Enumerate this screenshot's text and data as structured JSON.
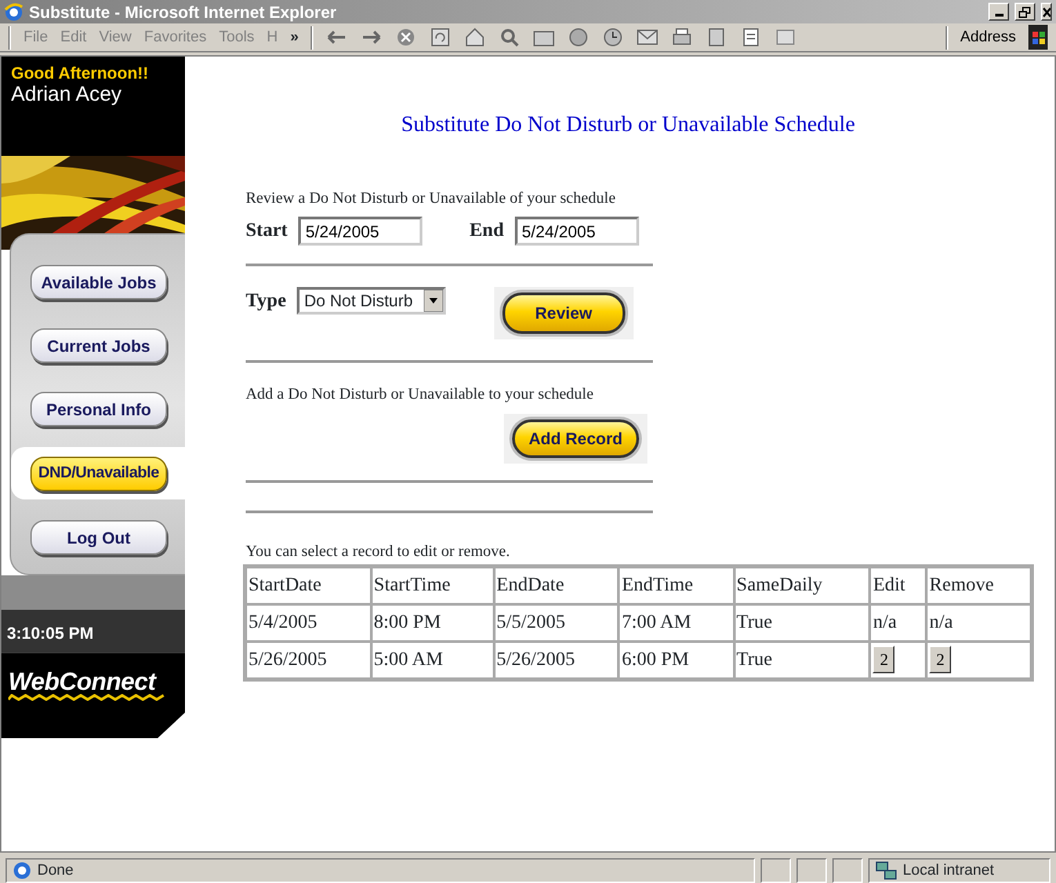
{
  "window": {
    "title": "Substitute - Microsoft Internet Explorer"
  },
  "menu": [
    {
      "label": "File"
    },
    {
      "label": "Edit"
    },
    {
      "label": "View"
    },
    {
      "label": "Favorites"
    },
    {
      "label": "Tools"
    },
    {
      "label": "H"
    }
  ],
  "menu_more": "»",
  "address_label": "Address",
  "sidebar": {
    "greeting": "Good Afternoon!!",
    "user_name": "Adrian Acey",
    "nav": [
      {
        "label": "Available Jobs",
        "selected": false
      },
      {
        "label": "Current Jobs",
        "selected": false
      },
      {
        "label": "Personal Info",
        "selected": false
      },
      {
        "label": "DND/Unavailable",
        "selected": true
      },
      {
        "label": "Log Out",
        "selected": false
      }
    ],
    "clock": "3:10:05 PM",
    "logo": "WebConnect"
  },
  "page": {
    "title": "Substitute Do Not Disturb or Unavailable Schedule",
    "review": {
      "caption": "Review a Do Not Disturb or Unavailable of your schedule",
      "start_label": "Start",
      "start_value": "5/24/2005",
      "end_label": "End",
      "end_value": "5/24/2005",
      "type_label": "Type",
      "type_value": "Do Not Disturb",
      "button": "Review"
    },
    "add": {
      "caption": "Add a Do Not Disturb or Unavailable to your schedule",
      "button": "Add Record"
    },
    "records": {
      "caption": "You can select a record to edit or remove.",
      "columns": [
        "StartDate",
        "StartTime",
        "EndDate",
        "EndTime",
        "SameDaily",
        "Edit",
        "Remove"
      ],
      "rows": [
        {
          "cells": [
            {
              "kind": "text",
              "text": "5/4/2005"
            },
            {
              "kind": "text",
              "text": "8:00 PM"
            },
            {
              "kind": "text",
              "text": "5/5/2005"
            },
            {
              "kind": "text",
              "text": "7:00 AM"
            },
            {
              "kind": "text",
              "text": "True"
            },
            {
              "kind": "text",
              "text": "n/a"
            },
            {
              "kind": "text",
              "text": "n/a"
            }
          ]
        },
        {
          "cells": [
            {
              "kind": "text",
              "text": "5/26/2005"
            },
            {
              "kind": "text",
              "text": "5:00 AM"
            },
            {
              "kind": "text",
              "text": "5/26/2005"
            },
            {
              "kind": "text",
              "text": "6:00 PM"
            },
            {
              "kind": "text",
              "text": "True"
            },
            {
              "kind": "button",
              "text": "2"
            },
            {
              "kind": "button",
              "text": "2"
            }
          ]
        }
      ]
    }
  },
  "status": {
    "text": "Done",
    "zone": "Local intranet"
  }
}
